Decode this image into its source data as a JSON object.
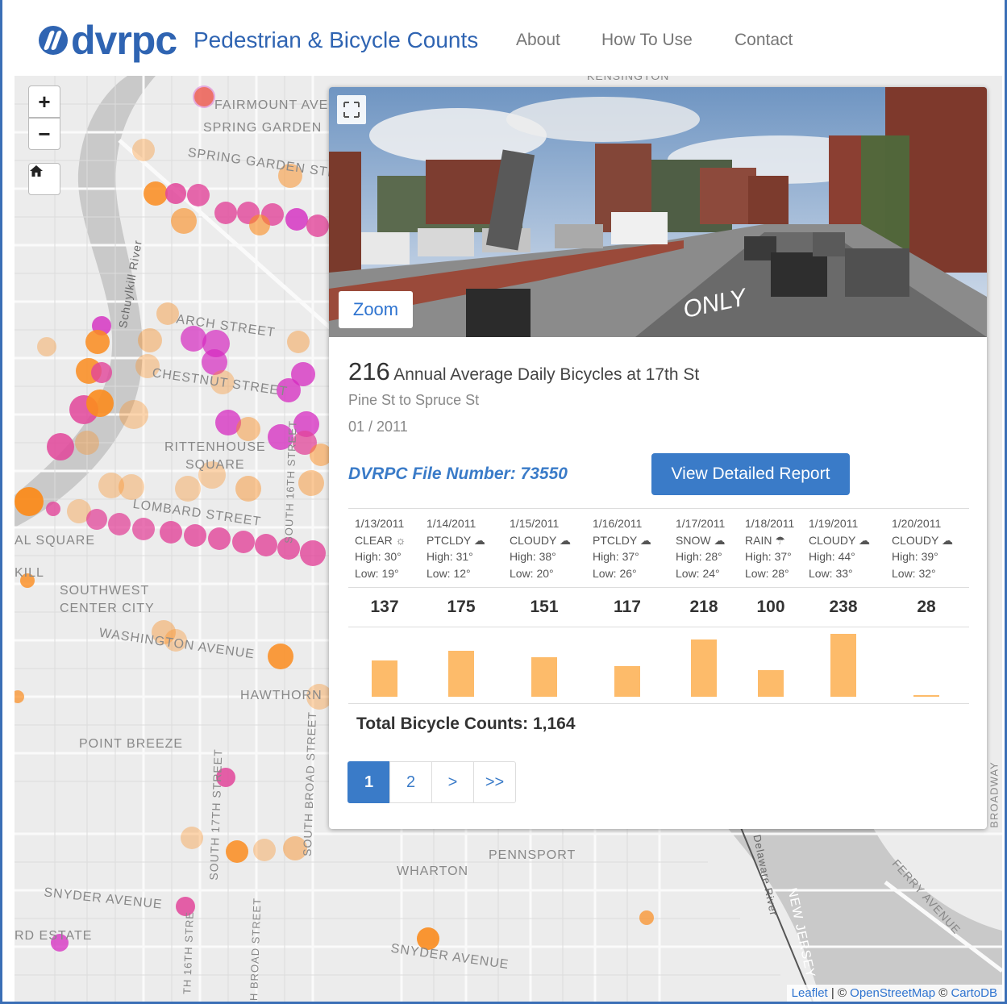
{
  "app": {
    "logo_text": "dvrpc",
    "title": "Pedestrian & Bicycle Counts",
    "nav": [
      "About",
      "How To Use",
      "Contact"
    ]
  },
  "map": {
    "zoom_in": "+",
    "zoom_out": "−",
    "home_icon": "home-icon",
    "labels": [
      "FAIRMOUNT AVE",
      "SPRING GARDEN",
      "SPRING GARDEN STR",
      "Schuylkill River",
      "ARCH STREET",
      "CHESTNUT STREET",
      "RITTENHOUSE",
      "SQUARE",
      "LOMBARD STREET",
      "AL SQUARE",
      "KILL",
      "SOUTHWEST",
      "CENTER CITY",
      "WASHINGTON AVENUE",
      "HAWTHORN",
      "POINT BREEZE",
      "SOUTH BROAD STREET",
      "SOUTH 17TH STREET",
      "SNYDER AVENUE",
      "RD ESTATE",
      "SNYDER AVENUE",
      "WHARTON",
      "PENNSPORT",
      "Delaware River",
      "NEW JERSEY",
      "FERRY AVENUE",
      "BROADWAY",
      "KENSINGTON",
      "SOUTH 16TH STREET",
      "TH BROAD STREET",
      "TH 16TH STRE"
    ],
    "attribution": {
      "leaflet": "Leaflet",
      "sep1": " | © ",
      "osm": "OpenStreetMap",
      "sep2": " © ",
      "carto": "CartoDB"
    },
    "colors": {
      "orange": "#fb8c1e",
      "magenta": "#d52ac0",
      "pink": "#e2459a"
    }
  },
  "popup": {
    "expand_icon": "expand-icon",
    "zoom_label": "Zoom",
    "aadb_value": "216",
    "aadb_text": "Annual Average Daily Bicycles at 17th St",
    "segment": "Pine St to Spruce St",
    "date": "01 / 2011",
    "file_number": "DVRPC File Number: 73550",
    "report_button": "View Detailed Report",
    "days": [
      {
        "date": "1/13/2011",
        "weather": "CLEAR",
        "icon": "sun-icon",
        "high": "High: 30°",
        "low": "Low: 19°",
        "count": "137"
      },
      {
        "date": "1/14/2011",
        "weather": "PTCLDY",
        "icon": "partly-cloudy-icon",
        "high": "High: 31°",
        "low": "Low: 12°",
        "count": "175"
      },
      {
        "date": "1/15/2011",
        "weather": "CLOUDY",
        "icon": "cloud-icon",
        "high": "High: 38°",
        "low": "Low: 20°",
        "count": "151"
      },
      {
        "date": "1/16/2011",
        "weather": "PTCLDY",
        "icon": "partly-cloudy-icon",
        "high": "High: 37°",
        "low": "Low: 26°",
        "count": "117"
      },
      {
        "date": "1/17/2011",
        "weather": "SNOW",
        "icon": "snow-icon",
        "high": "High: 28°",
        "low": "Low: 24°",
        "count": "218"
      },
      {
        "date": "1/18/2011",
        "weather": "RAIN",
        "icon": "rain-icon",
        "high": "High: 37°",
        "low": "Low: 28°",
        "count": "100"
      },
      {
        "date": "1/19/2011",
        "weather": "CLOUDY",
        "icon": "cloud-icon",
        "high": "High: 44°",
        "low": "Low: 33°",
        "count": "238"
      },
      {
        "date": "1/20/2011",
        "weather": "CLOUDY",
        "icon": "cloud-icon",
        "high": "High: 39°",
        "low": "Low: 32°",
        "count": "28"
      }
    ],
    "total": "Total Bicycle Counts: 1,164",
    "pagination": [
      "1",
      "2",
      ">",
      ">>"
    ],
    "bar_color": "#fdbb6a"
  },
  "chart_data": {
    "type": "bar",
    "categories": [
      "1/13/2011",
      "1/14/2011",
      "1/15/2011",
      "1/16/2011",
      "1/17/2011",
      "1/18/2011",
      "1/19/2011",
      "1/20/2011"
    ],
    "values": [
      137,
      175,
      151,
      117,
      218,
      100,
      238,
      28
    ]
  }
}
